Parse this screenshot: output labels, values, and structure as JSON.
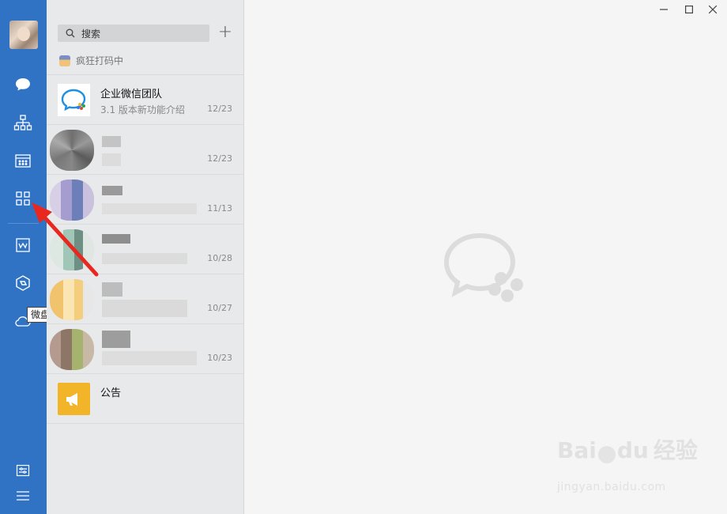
{
  "colors": {
    "nav_bg": "#3072c4",
    "list_bg": "#e8e9ea",
    "main_bg": "#f5f5f6",
    "annotation_arrow": "#e8281f",
    "announce_icon": "#f2b428"
  },
  "nav": {
    "icons": [
      "chat-icon",
      "contacts-icon",
      "calendar-icon",
      "workbench-icon",
      "document-icon",
      "drive-icon",
      "cloud-icon",
      "settings-icon",
      "menu-icon"
    ],
    "tooltip": "微盘"
  },
  "search": {
    "placeholder": "搜索"
  },
  "status": {
    "text": "疯狂打码中"
  },
  "conversations": [
    {
      "title": "企业微信团队",
      "subtitle": "3.1 版本新功能介绍",
      "time": "12/23"
    },
    {
      "title": "",
      "subtitle": "",
      "time": "12/23"
    },
    {
      "title": "",
      "subtitle": "",
      "time": "11/13"
    },
    {
      "title": "",
      "subtitle": "",
      "time": "10/28"
    },
    {
      "title": "",
      "subtitle": "",
      "time": "10/27"
    },
    {
      "title": "",
      "subtitle": "",
      "time": "10/23"
    },
    {
      "title": "公告",
      "subtitle": "",
      "time": ""
    }
  ],
  "watermark": {
    "brand": "Bai",
    "brand2": "du",
    "product": "经验",
    "url": "jingyan.baidu.com"
  }
}
